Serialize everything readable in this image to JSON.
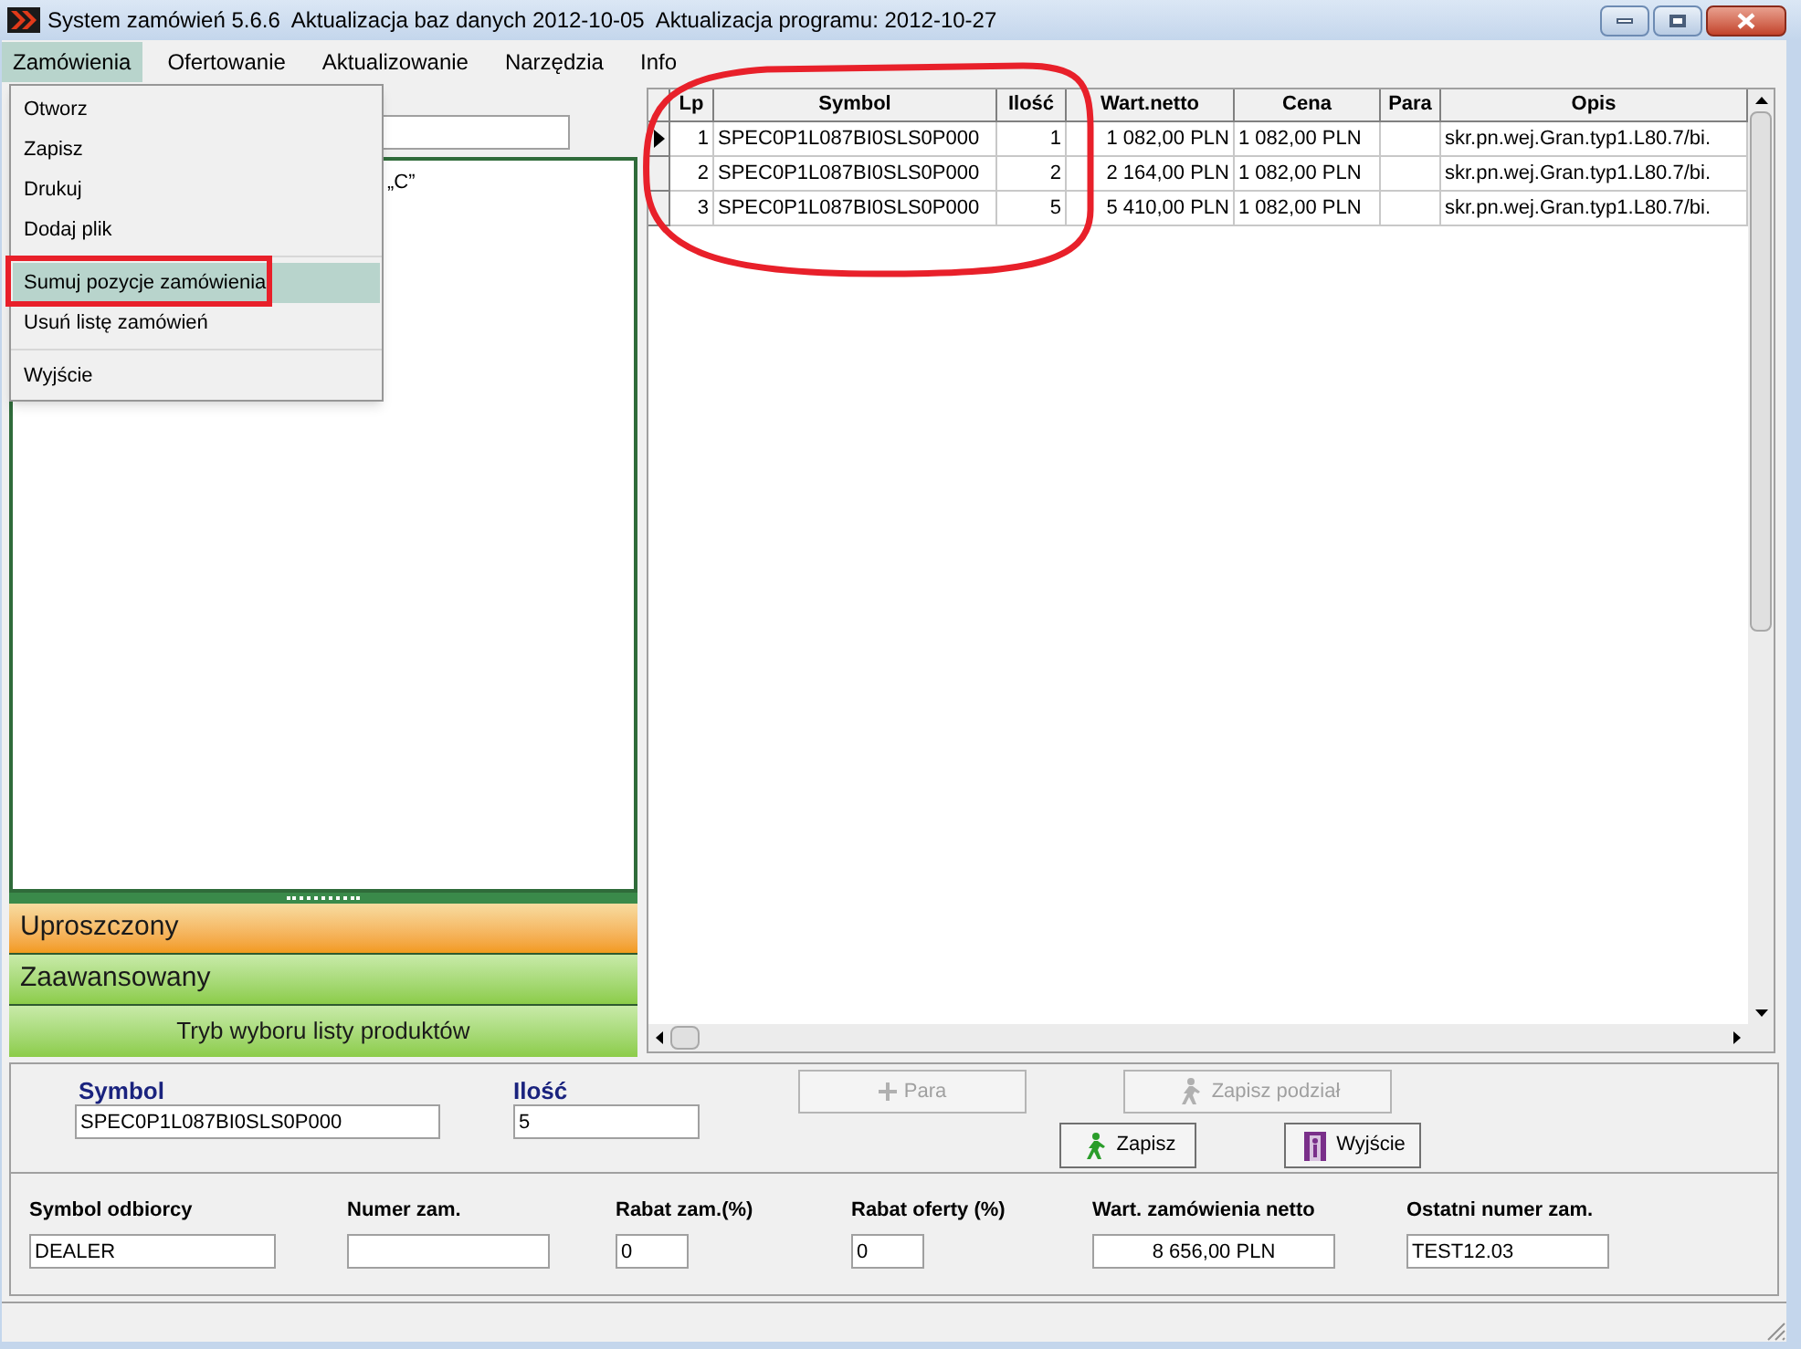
{
  "window": {
    "title": "System zamówień 5.6.6  Aktualizacja baz danych 2012-10-05  Aktualizacja programu: 2012-10-27"
  },
  "menu_bar": [
    {
      "label": "Zamówienia",
      "selected": true
    },
    {
      "label": "Ofertowanie",
      "selected": false
    },
    {
      "label": "Aktualizowanie",
      "selected": false
    },
    {
      "label": "Narzędzia",
      "selected": false
    },
    {
      "label": "Info",
      "selected": false
    }
  ],
  "dropdown": {
    "groups": [
      [
        {
          "label": "Otworz",
          "selected": false
        },
        {
          "label": "Zapisz",
          "selected": false
        },
        {
          "label": "Drukuj",
          "selected": false
        },
        {
          "label": "Dodaj plik",
          "selected": false
        }
      ],
      [
        {
          "label": "Sumuj pozycje zamówienia",
          "selected": true
        },
        {
          "label": "Usuń listę zamówień",
          "selected": false
        }
      ],
      [
        {
          "label": "Wyjście",
          "selected": false
        }
      ]
    ]
  },
  "left_panel": {
    "list_items": [
      "„C”"
    ],
    "modes": [
      {
        "label": "Uproszczony",
        "selected": true
      },
      {
        "label": "Zaawansowany",
        "selected": false
      }
    ],
    "mode_button": "Tryb wyboru listy produktów"
  },
  "table": {
    "columns": [
      "Lp",
      "Symbol",
      "Ilość",
      "Wart.netto",
      "Cena",
      "Para",
      "Opis"
    ],
    "rows": [
      {
        "selected": true,
        "cells": [
          "1",
          "SPEC0P1L087BI0SLS0P000",
          "1",
          "1 082,00 PLN",
          "1 082,00 PLN",
          "",
          "skr.pn.wej.Gran.typ1.L80.7/bi."
        ]
      },
      {
        "selected": false,
        "cells": [
          "2",
          "SPEC0P1L087BI0SLS0P000",
          "2",
          "2 164,00 PLN",
          "1 082,00 PLN",
          "",
          "skr.pn.wej.Gran.typ1.L80.7/bi."
        ]
      },
      {
        "selected": false,
        "cells": [
          "3",
          "SPEC0P1L087BI0SLS0P000",
          "5",
          "5 410,00 PLN",
          "1 082,00 PLN",
          "",
          "skr.pn.wej.Gran.typ1.L80.7/bi."
        ]
      }
    ]
  },
  "entry": {
    "symbol": {
      "label": "Symbol",
      "value": "SPEC0P1L087BI0SLS0P000"
    },
    "quantity": {
      "label": "Ilość",
      "value": "5"
    },
    "buttons": [
      {
        "label": "Para",
        "disabled": true,
        "kind": "plus"
      },
      {
        "label": "Zapisz podział",
        "disabled": true,
        "kind": "walker"
      },
      {
        "label": "Zapisz",
        "disabled": false,
        "kind": "walker"
      },
      {
        "label": "Wyjście",
        "disabled": false,
        "kind": "door"
      }
    ]
  },
  "order_fields": [
    {
      "label": "Symbol odbiorcy",
      "value": "DEALER"
    },
    {
      "label": "Numer zam."
    },
    {
      "label": "Rabat zam.(%)",
      "value": "0"
    },
    {
      "label": "Rabat oferty (%)",
      "value": "0"
    },
    {
      "label": "Wart. zamówienia netto",
      "value": "8 656,00 PLN"
    },
    {
      "label": "Ostatni numer zam.",
      "value": "TEST12.03"
    }
  ]
}
